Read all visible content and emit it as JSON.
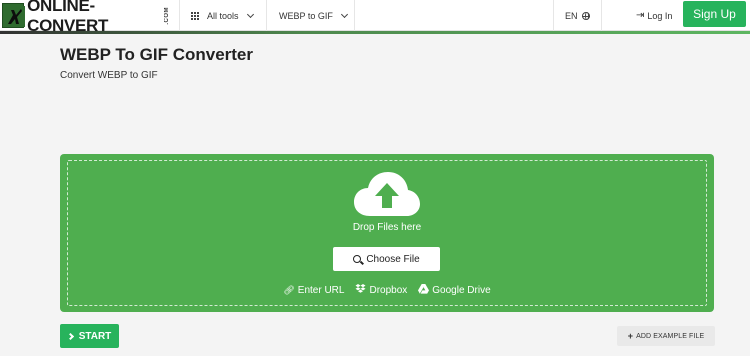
{
  "header": {
    "logo_text": "ONLINE-CONVERT",
    "logo_com": ".COM",
    "nav": {
      "all_tools": "All tools",
      "webp_to_gif": "WEBP to GIF",
      "language": "EN",
      "login": "Log In",
      "signup": "Sign Up"
    }
  },
  "page": {
    "title": "WEBP To GIF Converter",
    "subtitle": "Convert WEBP to GIF"
  },
  "dropzone": {
    "drop_text": "Drop Files here",
    "choose_label": "Choose File",
    "sources": {
      "url": "Enter URL",
      "dropbox": "Dropbox",
      "gdrive": "Google Drive"
    }
  },
  "actions": {
    "start": "START",
    "example": "ADD EXAMPLE FILE"
  },
  "colors": {
    "brand_green": "#27b35c",
    "dropzone_green": "#4fae4f",
    "background": "#f4f4f4"
  },
  "icons": [
    "upload-cloud-icon",
    "search-icon",
    "link-icon",
    "dropbox-icon",
    "google-drive-icon",
    "globe-icon",
    "login-icon",
    "grid-icon",
    "chevron-down-icon",
    "chevron-right-icon",
    "plus-icon"
  ]
}
